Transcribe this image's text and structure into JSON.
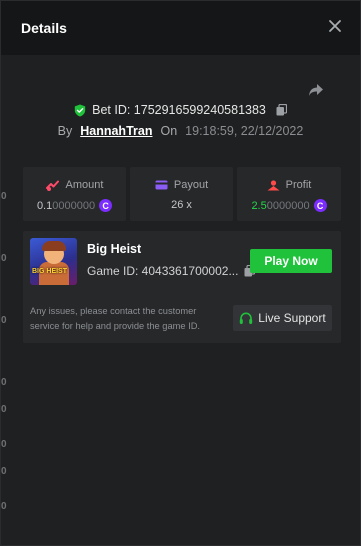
{
  "header": {
    "title": "Details"
  },
  "bet": {
    "id_label": "Bet ID: 1752916599240581383",
    "by_label": "By",
    "username": "HannahTran",
    "on_label": "On",
    "datetime": "19:18:59, 22/12/2022"
  },
  "stats": {
    "amount": {
      "label": "Amount",
      "value_main": "0.1",
      "value_rest": "0000000"
    },
    "payout": {
      "label": "Payout",
      "value": "26 x"
    },
    "profit": {
      "label": "Profit",
      "value_main": "2.5",
      "value_rest": "0000000"
    }
  },
  "game": {
    "name": "Big Heist",
    "id_label": "Game ID: 4043361700002...",
    "thumb_text": "BIG HEIST",
    "play_label": "Play Now",
    "note": "Any issues, please contact the customer service for help and provide the game ID.",
    "support_label": "Live Support"
  },
  "edge_glyphs": [
    "0",
    "0",
    "0",
    "0",
    "0",
    "0",
    "0",
    "0"
  ],
  "colors": {
    "accent_green": "#1fc23a",
    "coin_purple": "#7b2cff",
    "amount_icon": "#ff4a6a",
    "payout_icon": "#8b5cf6",
    "profit_icon": "#ff4a4a"
  },
  "icons": {
    "close": "close-icon",
    "share": "share-icon",
    "shield": "shield-check-icon",
    "copy": "copy-icon",
    "coin": "coin-icon",
    "headset": "headset-icon"
  }
}
